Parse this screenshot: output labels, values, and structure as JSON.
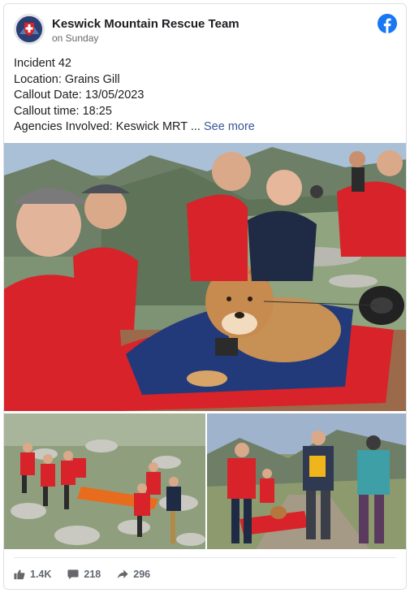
{
  "post": {
    "page_name": "Keswick Mountain Rescue Team",
    "time": "on Sunday",
    "lines": [
      "Incident 42",
      "Location: Grains Gill",
      "Callout Date: 13/05/2023",
      "Callout time: 18:25",
      "Agencies Involved: Keswick MRT ..."
    ],
    "see_more": "See more"
  },
  "photos": {
    "main": "Rescue team members in red jackets with a dog lying on a blue blanket on a stretcher",
    "left": "Team carrying a stretcher over rocky ground",
    "right": "Team walking down a valley path with a stretcher"
  },
  "stats": {
    "likes": "1.4K",
    "comments": "218",
    "shares": "296"
  },
  "icons": {
    "facebook": "facebook-logo-icon",
    "like": "thumbs-up-icon",
    "comment": "comment-icon",
    "share": "share-arrow-icon"
  },
  "colors": {
    "facebook_blue": "#1877f2",
    "link": "#385898",
    "jacket_red": "#d8232a"
  }
}
